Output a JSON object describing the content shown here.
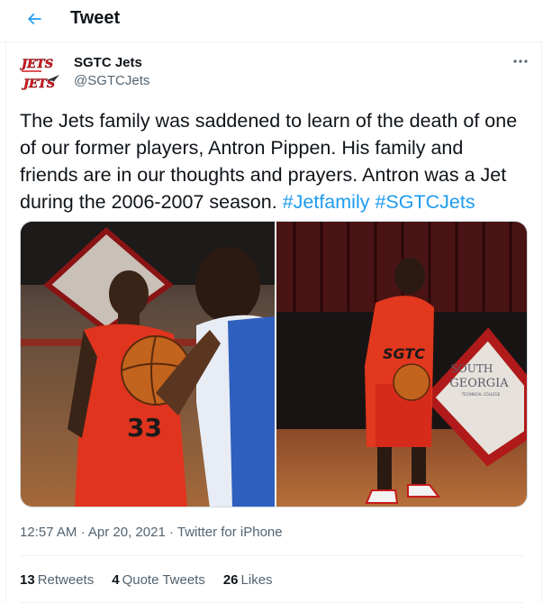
{
  "header": {
    "title": "Tweet",
    "back_icon": "arrow-left-icon"
  },
  "author": {
    "name": "SGTC Jets",
    "handle": "@SGTCJets",
    "avatar_logo_text": "JETS",
    "colors": {
      "logo_red": "#d71920"
    }
  },
  "tweet": {
    "text": "The Jets family was saddened to learn of the death of one of our former players, Antron Pippen. His family and friends are in our thoughts and prayers. Antron was a Jet during the 2006-2007 season.",
    "hashtags": [
      "#Jetfamily",
      "#SGTCJets"
    ]
  },
  "media": {
    "left_photo_jersey_number": "33",
    "right_photo_jersey_text": "SGTC",
    "right_photo_wall_sign": [
      "SOUTH",
      "GEORGIA",
      "TECHNICAL COLLEGE"
    ]
  },
  "meta": {
    "time": "12:57 AM",
    "separator": "·",
    "date": "Apr 20, 2021",
    "source": "Twitter for iPhone"
  },
  "stats": {
    "retweets_count": "13",
    "retweets_label": "Retweets",
    "quotes_count": "4",
    "quotes_label": "Quote Tweets",
    "likes_count": "26",
    "likes_label": "Likes"
  },
  "colors": {
    "link_blue": "#1d9bf0",
    "secondary_text": "#536471",
    "divider": "#eff3f4"
  },
  "icons": {
    "more": "more-horizontal-icon"
  }
}
